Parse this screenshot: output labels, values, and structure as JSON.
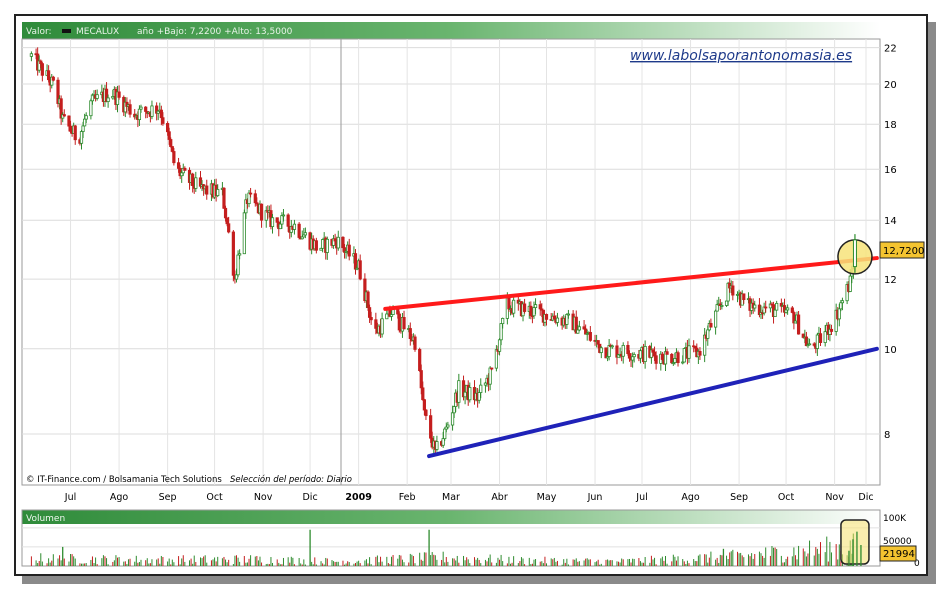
{
  "header": {
    "valor_label": "Valor:",
    "ticker": "MECALUX",
    "range_text": "año +Bajo: 7,2200 +Alto: 13,5000"
  },
  "watermark": "www.labolsaporantonomasia.es",
  "footer": {
    "credits": "© IT-Finance.com / Bolsamania Tech Solutions",
    "period": "Selección del período: Diario"
  },
  "price_badge": "12,7200",
  "volume_panel": {
    "title": "Volumen",
    "badge": "21994",
    "ticks": [
      "100K",
      "50000",
      "0"
    ]
  },
  "colors": {
    "up": "#2e8b2e",
    "down": "#c41e1e",
    "resistance": "#ff1a1a",
    "support": "#1f22b8",
    "highlight": "#f7e37a",
    "badge": "#f4c430",
    "header_green": "#2f8b3a"
  },
  "chart_data": {
    "type": "candlestick",
    "y_scale": "log",
    "ylim": [
      7.0,
      22.5
    ],
    "y_ticks": [
      8,
      10,
      12,
      14,
      16,
      18,
      20,
      22
    ],
    "x_ticks": [
      "Jul",
      "Ago",
      "Sep",
      "Oct",
      "Nov",
      "Dic",
      "2009",
      "Feb",
      "Mar",
      "Abr",
      "May",
      "Jun",
      "Jul",
      "Ago",
      "Sep",
      "Oct",
      "Nov",
      "Dic"
    ],
    "last_price": 12.72,
    "close_profile": [
      [
        "2008-06-20",
        21.5
      ],
      [
        "2008-07-05",
        19.8
      ],
      [
        "2008-07-10",
        18.2
      ],
      [
        "2008-07-20",
        17.3
      ],
      [
        "2008-07-28",
        19.0
      ],
      [
        "2008-08-10",
        19.6
      ],
      [
        "2008-08-25",
        18.5
      ],
      [
        "2008-09-10",
        18.8
      ],
      [
        "2008-09-20",
        16.0
      ],
      [
        "2008-10-05",
        15.2
      ],
      [
        "2008-10-20",
        15.0
      ],
      [
        "2008-10-28",
        12.0
      ],
      [
        "2008-11-05",
        14.8
      ],
      [
        "2008-11-20",
        14.0
      ],
      [
        "2008-12-05",
        13.8
      ],
      [
        "2008-12-20",
        13.0
      ],
      [
        "2009-01-01",
        13.3
      ],
      [
        "2009-01-15",
        12.4
      ],
      [
        "2009-01-25",
        10.4
      ],
      [
        "2009-02-05",
        11.0
      ],
      [
        "2009-02-20",
        10.2
      ],
      [
        "2009-02-26",
        8.4
      ],
      [
        "2009-03-05",
        7.6
      ],
      [
        "2009-03-12",
        8.1
      ],
      [
        "2009-03-20",
        9.0
      ],
      [
        "2009-04-01",
        8.8
      ],
      [
        "2009-04-10",
        9.4
      ],
      [
        "2009-04-20",
        11.2
      ],
      [
        "2009-05-10",
        11.0
      ],
      [
        "2009-06-01",
        10.7
      ],
      [
        "2009-06-20",
        10.0
      ],
      [
        "2009-07-10",
        9.9
      ],
      [
        "2009-08-01",
        9.8
      ],
      [
        "2009-08-20",
        9.9
      ],
      [
        "2009-09-01",
        11.0
      ],
      [
        "2009-09-10",
        11.8
      ],
      [
        "2009-09-20",
        11.2
      ],
      [
        "2009-10-05",
        11.1
      ],
      [
        "2009-10-20",
        10.9
      ],
      [
        "2009-10-30",
        10.0
      ],
      [
        "2009-11-05",
        10.2
      ],
      [
        "2009-11-15",
        10.8
      ],
      [
        "2009-11-25",
        11.9
      ],
      [
        "2009-11-28",
        12.72
      ]
    ],
    "trendlines": [
      {
        "name": "resistance",
        "points": [
          [
            "2009-02-01",
            11.1
          ],
          [
            "2009-12-12",
            12.68
          ]
        ]
      },
      {
        "name": "support",
        "points": [
          [
            "2009-03-01",
            7.55
          ],
          [
            "2009-12-12",
            10.0
          ]
        ]
      }
    ],
    "highlight_point": [
      "2009-11-28",
      12.72
    ],
    "volume_ylim": [
      0,
      110000
    ],
    "volume_profile": [
      [
        "2008-06-20",
        25000
      ],
      [
        "2008-09-01",
        20000
      ],
      [
        "2008-11-10",
        22000
      ],
      [
        "2009-01-01",
        15000
      ],
      [
        "2009-03-10",
        28000
      ],
      [
        "2009-05-01",
        18000
      ],
      [
        "2009-07-01",
        15000
      ],
      [
        "2009-09-10",
        30000
      ],
      [
        "2009-11-20",
        60000
      ]
    ],
    "volume_spikes": [
      [
        "2008-07-10",
        50000
      ],
      [
        "2008-12-15",
        95000
      ],
      [
        "2009-03-01",
        95000
      ],
      [
        "2009-09-05",
        45000
      ],
      [
        "2009-11-27",
        85000
      ]
    ]
  }
}
